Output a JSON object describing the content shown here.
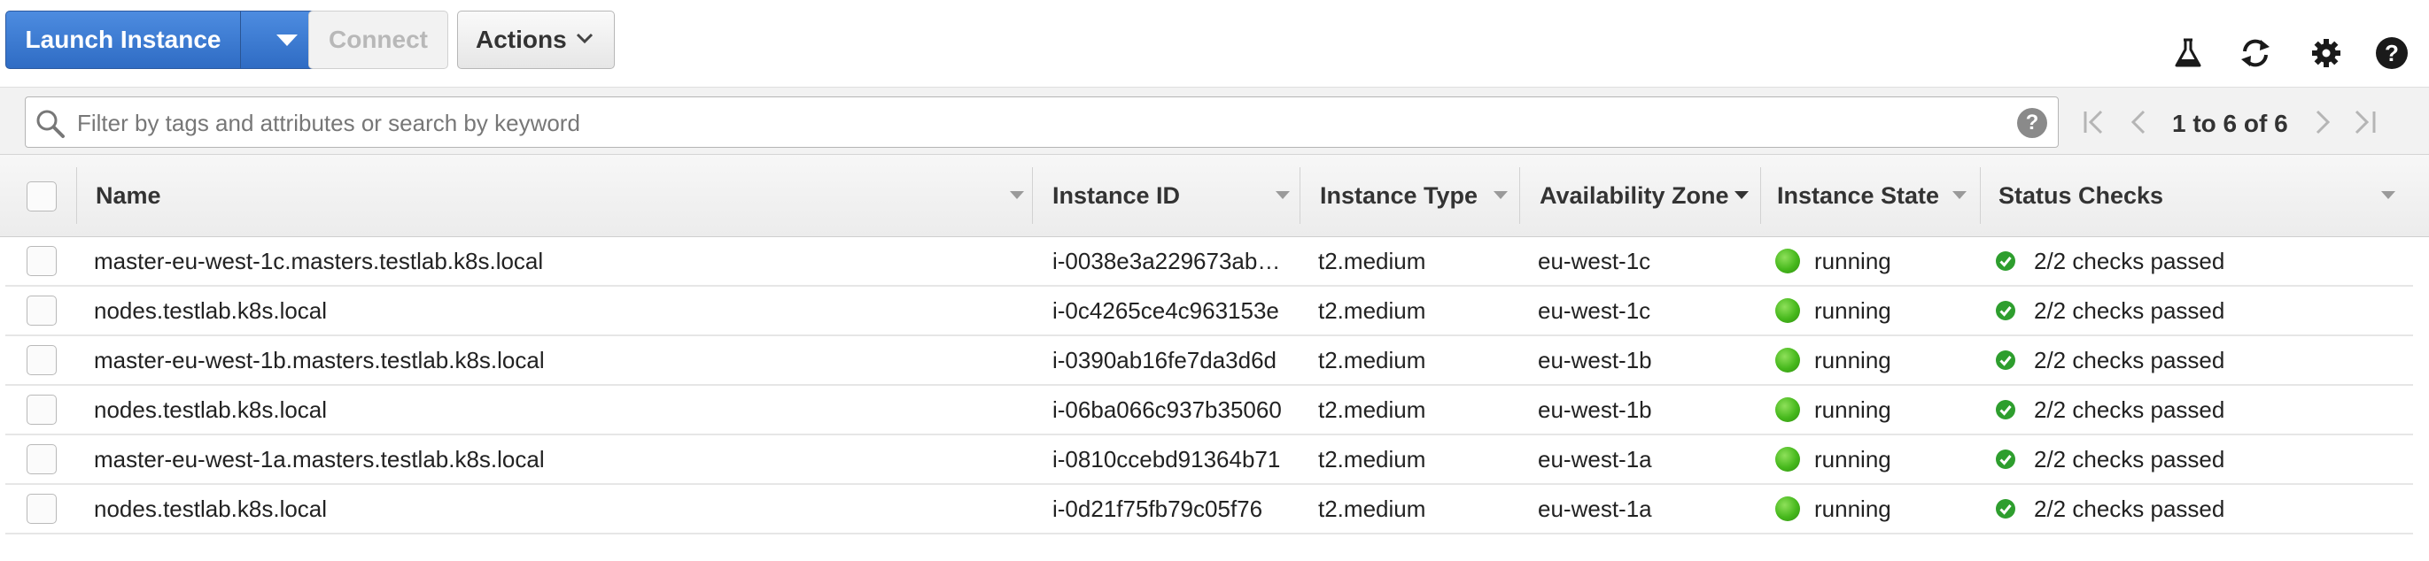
{
  "toolbar": {
    "launch_label": "Launch Instance",
    "connect_label": "Connect",
    "actions_label": "Actions",
    "icons": [
      "flask-icon",
      "refresh-icon",
      "gear-icon",
      "help-icon"
    ]
  },
  "search": {
    "placeholder": "Filter by tags and attributes or search by keyword",
    "help_glyph": "?"
  },
  "pagination": {
    "label": "1 to 6 of 6"
  },
  "table": {
    "columns": {
      "name": "Name",
      "instance_id": "Instance ID",
      "instance_type": "Instance Type",
      "availability_zone": "Availability Zone",
      "instance_state": "Instance State",
      "status_checks": "Status Checks"
    },
    "rows": [
      {
        "name": "master-eu-west-1c.masters.testlab.k8s.local",
        "instance_id": "i-0038e3a229673ab…",
        "instance_type": "t2.medium",
        "zone": "eu-west-1c",
        "state": "running",
        "checks": "2/2 checks passed"
      },
      {
        "name": "nodes.testlab.k8s.local",
        "instance_id": "i-0c4265ce4c963153e",
        "instance_type": "t2.medium",
        "zone": "eu-west-1c",
        "state": "running",
        "checks": "2/2 checks passed"
      },
      {
        "name": "master-eu-west-1b.masters.testlab.k8s.local",
        "instance_id": "i-0390ab16fe7da3d6d",
        "instance_type": "t2.medium",
        "zone": "eu-west-1b",
        "state": "running",
        "checks": "2/2 checks passed"
      },
      {
        "name": "nodes.testlab.k8s.local",
        "instance_id": "i-06ba066c937b35060",
        "instance_type": "t2.medium",
        "zone": "eu-west-1b",
        "state": "running",
        "checks": "2/2 checks passed"
      },
      {
        "name": "master-eu-west-1a.masters.testlab.k8s.local",
        "instance_id": "i-0810ccebd91364b71",
        "instance_type": "t2.medium",
        "zone": "eu-west-1a",
        "state": "running",
        "checks": "2/2 checks passed"
      },
      {
        "name": "nodes.testlab.k8s.local",
        "instance_id": "i-0d21f75fb79c05f76",
        "instance_type": "t2.medium",
        "zone": "eu-west-1a",
        "state": "running",
        "checks": "2/2 checks passed"
      }
    ]
  },
  "colors": {
    "primary_button": "#2f6cc4",
    "running": "#46b81c",
    "checks_passed": "#2e9e2e"
  }
}
